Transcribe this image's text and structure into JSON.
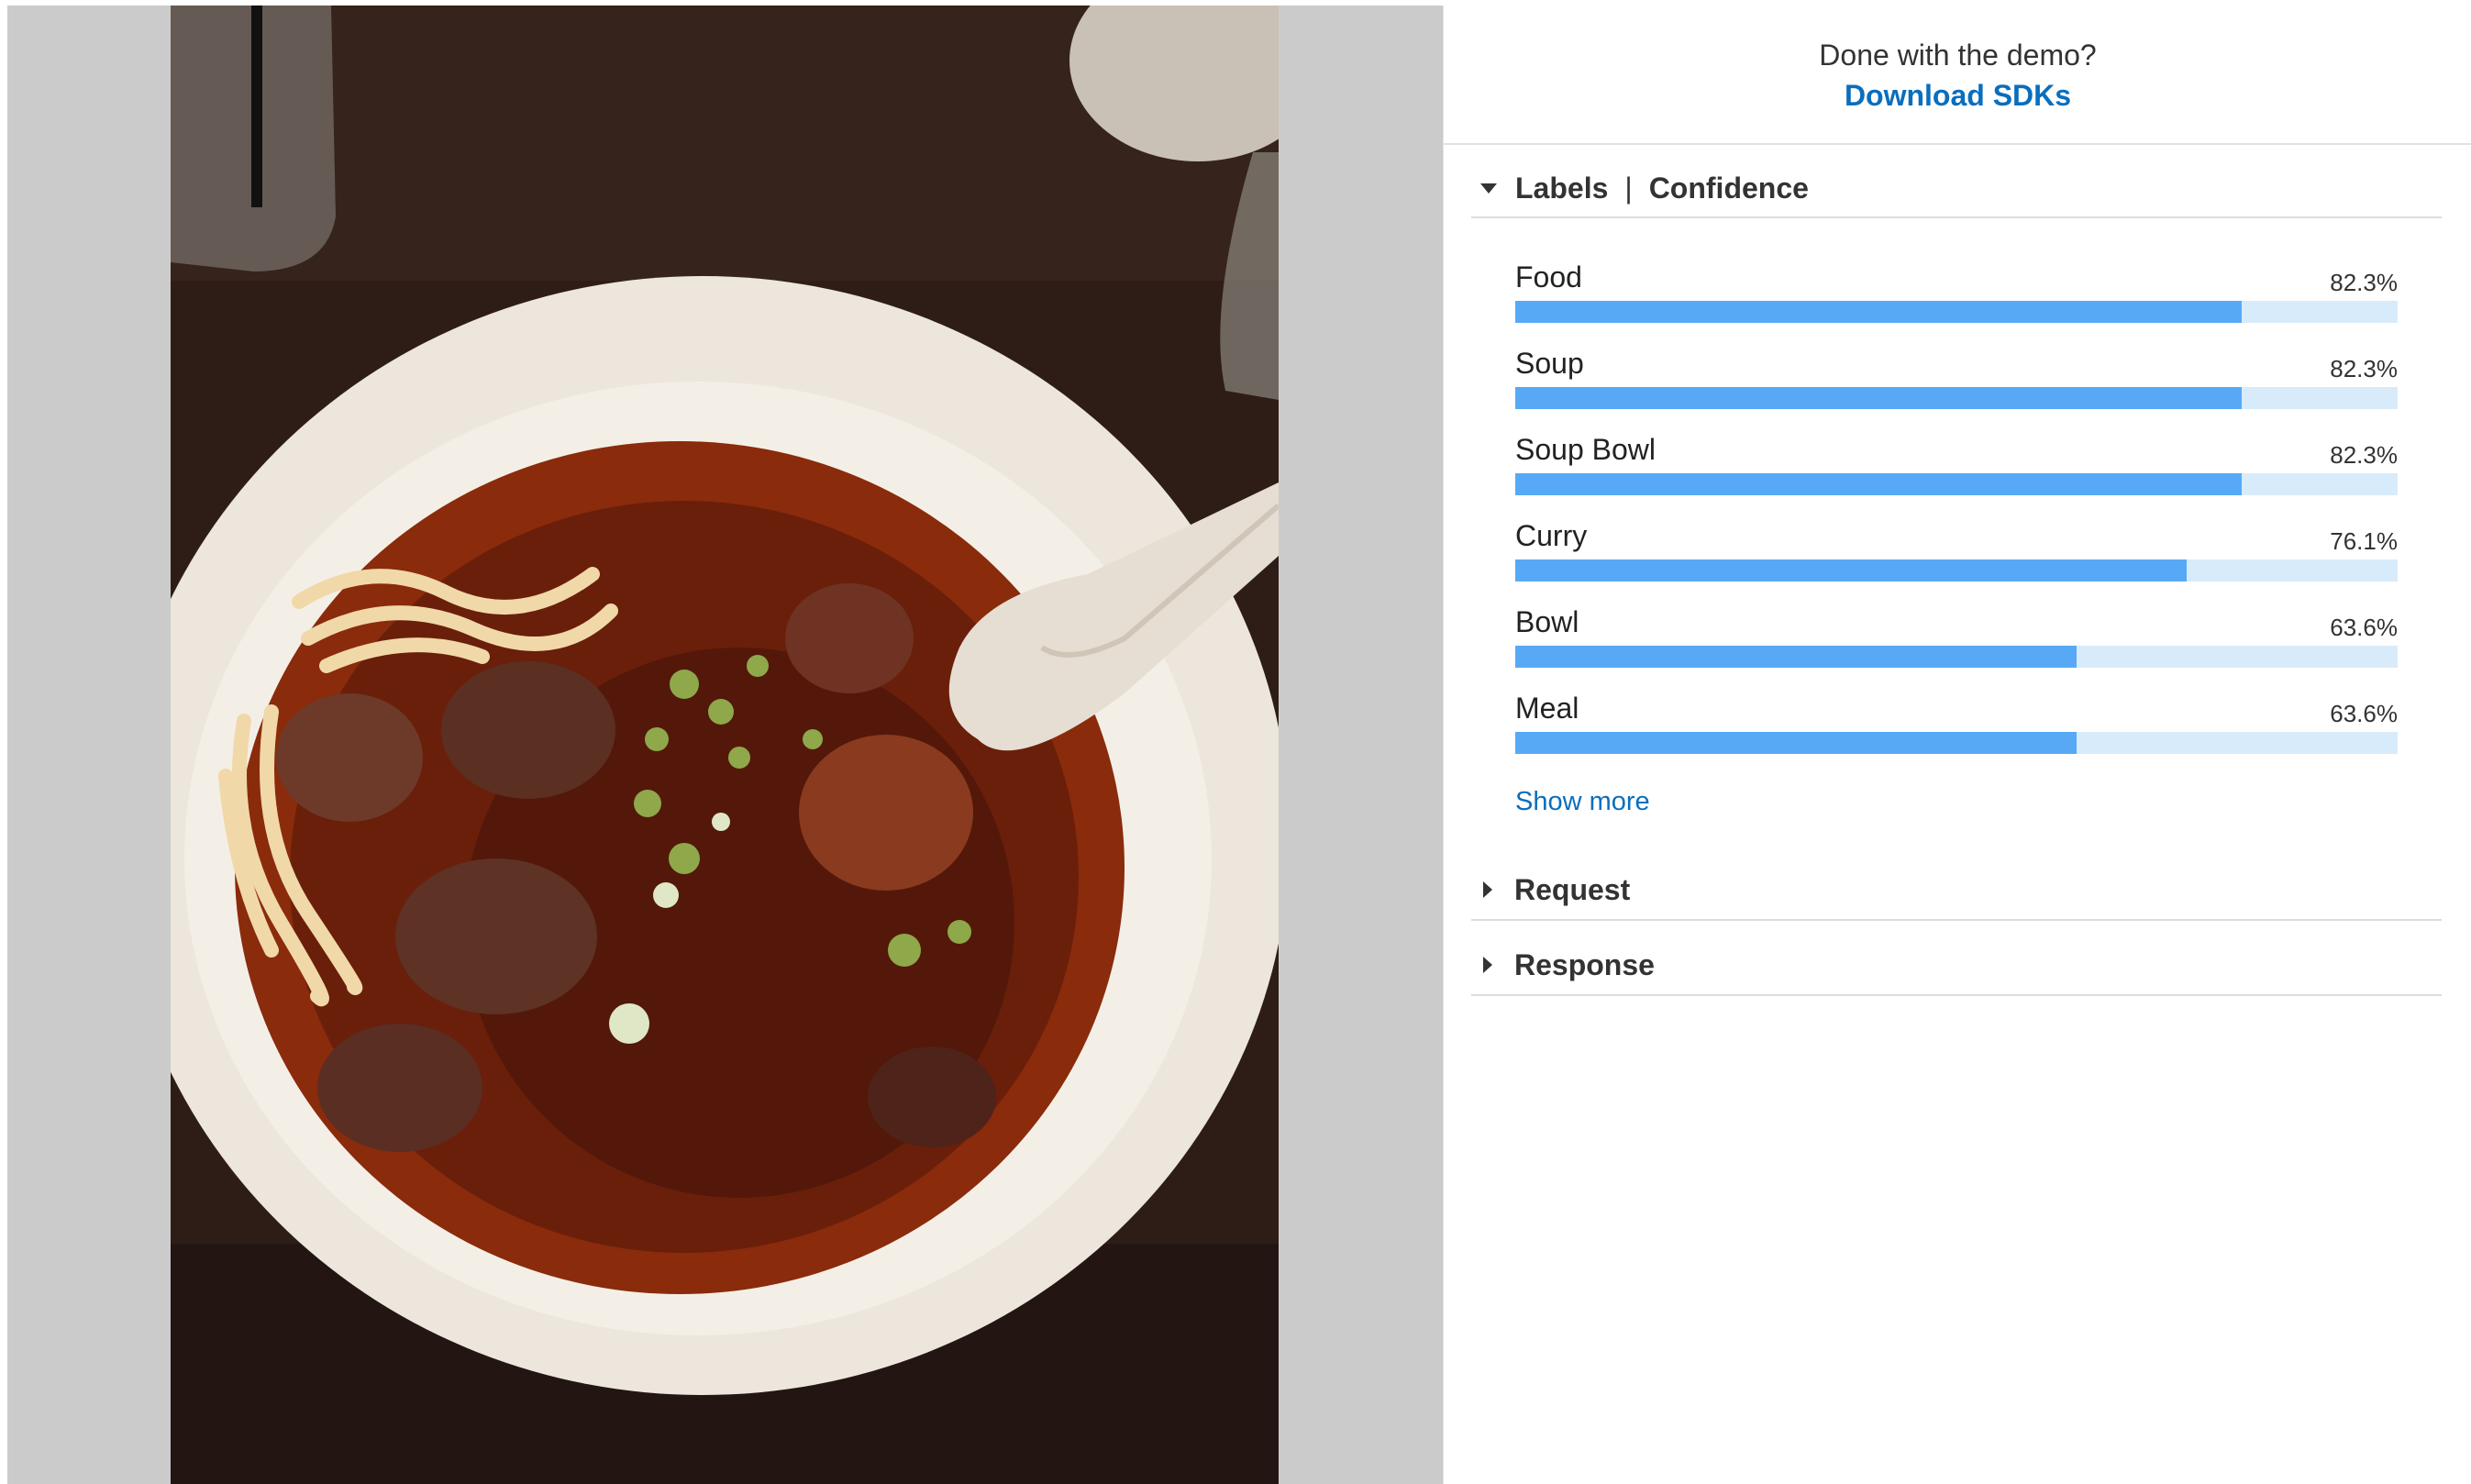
{
  "demo_prompt": {
    "text": "Done with the demo?",
    "link_label": "Download SDKs"
  },
  "labels_section": {
    "title": "Labels",
    "separator": "|",
    "subtitle": "Confidence",
    "items": [
      {
        "label": "Food",
        "confidence_text": "82.3%",
        "confidence": 82.3
      },
      {
        "label": "Soup",
        "confidence_text": "82.3%",
        "confidence": 82.3
      },
      {
        "label": "Soup Bowl",
        "confidence_text": "82.3%",
        "confidence": 82.3
      },
      {
        "label": "Curry",
        "confidence_text": "76.1%",
        "confidence": 76.1
      },
      {
        "label": "Bowl",
        "confidence_text": "63.6%",
        "confidence": 63.6
      },
      {
        "label": "Meal",
        "confidence_text": "63.6%",
        "confidence": 63.6
      }
    ],
    "show_more_label": "Show more"
  },
  "request_section": {
    "title": "Request"
  },
  "response_section": {
    "title": "Response"
  },
  "colors": {
    "bar_fill": "#57a9f6",
    "bar_track": "#d8ebfa",
    "link": "#0a6ebd"
  }
}
